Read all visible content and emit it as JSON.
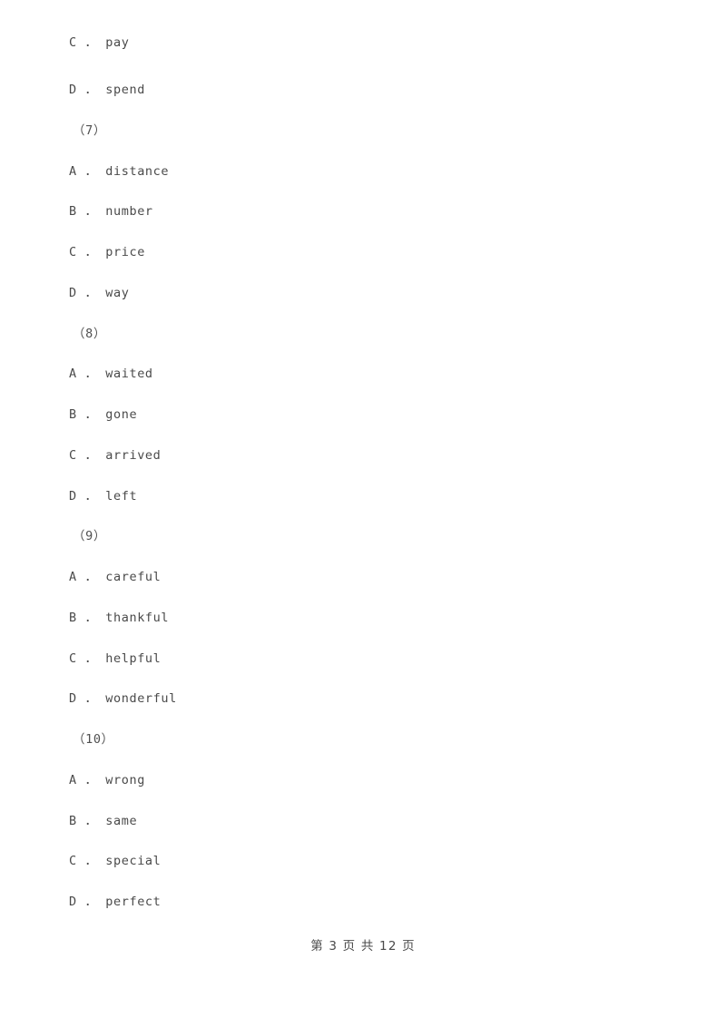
{
  "document": {
    "page_label": "第 3 页 共 12 页",
    "page_number": "3",
    "total_pages": "12",
    "text_color": "#4a4a4a",
    "background_color": "#ffffff"
  },
  "lines": [
    {
      "type": "option",
      "letter": "C",
      "sep": "．",
      "word": "pay",
      "text": "C ． pay"
    },
    {
      "type": "option",
      "letter": "D",
      "sep": "．",
      "word": "spend",
      "text": "D ． spend"
    },
    {
      "type": "question_number",
      "text": "（7）"
    },
    {
      "type": "option",
      "letter": "A",
      "sep": "．",
      "word": "distance",
      "text": "A ． distance"
    },
    {
      "type": "option",
      "letter": "B",
      "sep": "．",
      "word": "number",
      "text": "B ． number"
    },
    {
      "type": "option",
      "letter": "C",
      "sep": "．",
      "word": "price",
      "text": "C ． price"
    },
    {
      "type": "option",
      "letter": "D",
      "sep": "．",
      "word": "way",
      "text": "D ． way"
    },
    {
      "type": "question_number",
      "text": "（8）"
    },
    {
      "type": "option",
      "letter": "A",
      "sep": "．",
      "word": "waited",
      "text": "A ． waited"
    },
    {
      "type": "option",
      "letter": "B",
      "sep": "．",
      "word": "gone",
      "text": "B ． gone"
    },
    {
      "type": "option",
      "letter": "C",
      "sep": "．",
      "word": "arrived",
      "text": "C ． arrived"
    },
    {
      "type": "option",
      "letter": "D",
      "sep": "．",
      "word": "left",
      "text": "D ． left"
    },
    {
      "type": "question_number",
      "text": "（9）"
    },
    {
      "type": "option",
      "letter": "A",
      "sep": "．",
      "word": "careful",
      "text": "A ． careful"
    },
    {
      "type": "option",
      "letter": "B",
      "sep": "．",
      "word": "thankful",
      "text": "B ． thankful"
    },
    {
      "type": "option",
      "letter": "C",
      "sep": "．",
      "word": "helpful",
      "text": "C ． helpful"
    },
    {
      "type": "option",
      "letter": "D",
      "sep": "．",
      "word": "wonderful",
      "text": "D ． wonderful"
    },
    {
      "type": "question_number",
      "text": "（10）"
    },
    {
      "type": "option",
      "letter": "A",
      "sep": "．",
      "word": "wrong",
      "text": "A ． wrong"
    },
    {
      "type": "option",
      "letter": "B",
      "sep": "．",
      "word": "same",
      "text": "B ． same"
    },
    {
      "type": "option",
      "letter": "C",
      "sep": "．",
      "word": "special",
      "text": "C ． special"
    },
    {
      "type": "option",
      "letter": "D",
      "sep": "．",
      "word": "perfect",
      "text": "D ． perfect"
    }
  ]
}
